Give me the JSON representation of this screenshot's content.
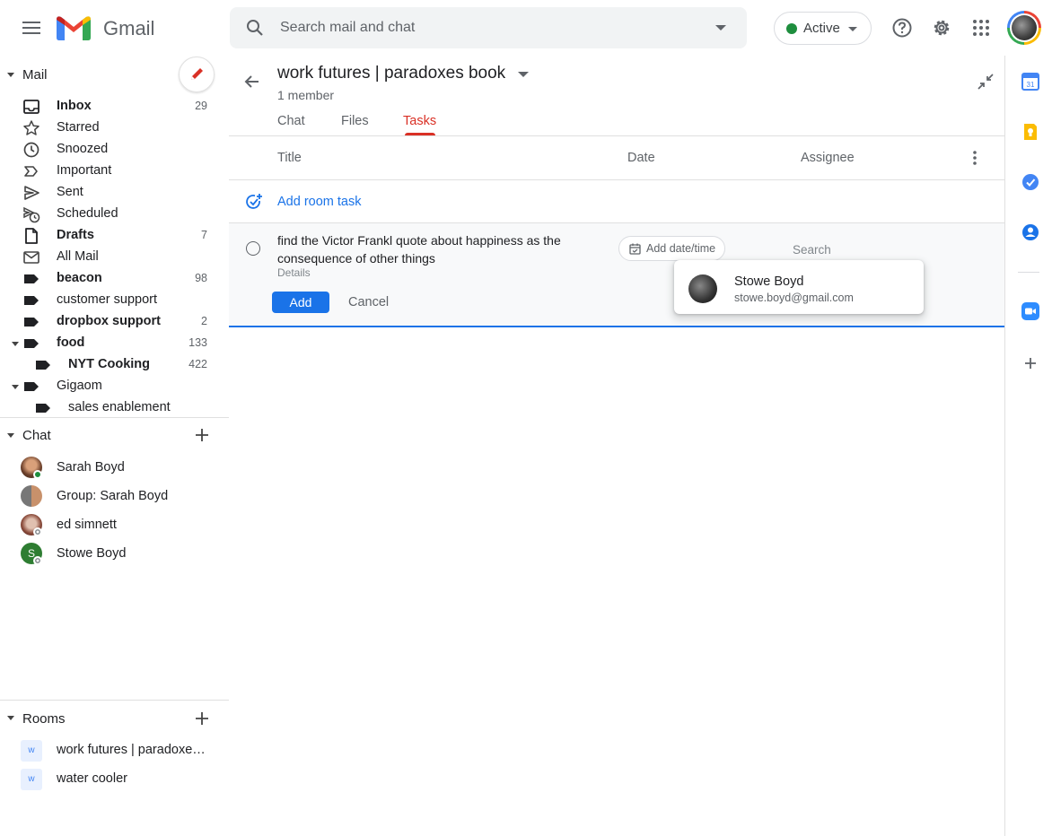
{
  "app": {
    "name": "Gmail"
  },
  "search": {
    "placeholder": "Search mail and chat"
  },
  "status": {
    "label": "Active",
    "color": "#1e8e3e"
  },
  "mail": {
    "section_title": "Mail",
    "items": [
      {
        "label": "Inbox",
        "count": "29",
        "icon": "inbox-icon",
        "bold": true
      },
      {
        "label": "Starred",
        "count": "",
        "icon": "star-icon",
        "bold": false
      },
      {
        "label": "Snoozed",
        "count": "",
        "icon": "clock-icon",
        "bold": false
      },
      {
        "label": "Important",
        "count": "",
        "icon": "important-icon",
        "bold": false
      },
      {
        "label": "Sent",
        "count": "",
        "icon": "send-icon",
        "bold": false
      },
      {
        "label": "Scheduled",
        "count": "",
        "icon": "scheduled-icon",
        "bold": false
      },
      {
        "label": "Drafts",
        "count": "7",
        "icon": "draft-icon",
        "bold": true
      },
      {
        "label": "All Mail",
        "count": "",
        "icon": "mail-icon",
        "bold": false
      },
      {
        "label": "beacon",
        "count": "98",
        "icon": "label-icon",
        "bold": true
      },
      {
        "label": "customer support",
        "count": "",
        "icon": "label-icon",
        "bold": false
      },
      {
        "label": "dropbox support",
        "count": "2",
        "icon": "label-icon",
        "bold": true
      },
      {
        "label": "food",
        "count": "133",
        "icon": "label-icon",
        "bold": true
      },
      {
        "label": "NYT Cooking",
        "count": "422",
        "icon": "label-icon",
        "bold": true
      },
      {
        "label": "Gigaom",
        "count": "",
        "icon": "label-icon",
        "bold": false
      },
      {
        "label": "sales enablement",
        "count": "",
        "icon": "label-icon",
        "bold": false
      }
    ]
  },
  "chat": {
    "section_title": "Chat",
    "items": [
      {
        "label": "Sarah Boyd"
      },
      {
        "label": "Group: Sarah Boyd"
      },
      {
        "label": "ed simnett"
      },
      {
        "label": "Stowe Boyd",
        "initial": "S"
      }
    ]
  },
  "rooms": {
    "section_title": "Rooms",
    "items": [
      {
        "label": "work futures | paradoxes book",
        "initial": "w"
      },
      {
        "label": "water cooler",
        "initial": "w"
      }
    ]
  },
  "room": {
    "title": "work futures | paradoxes book",
    "members": "1 member",
    "tabs": [
      {
        "label": "Chat",
        "active": false
      },
      {
        "label": "Files",
        "active": false
      },
      {
        "label": "Tasks",
        "active": true
      }
    ]
  },
  "tasks": {
    "columns": {
      "title": "Title",
      "date": "Date",
      "assignee": "Assignee"
    },
    "add_task_label": "Add room task",
    "editor": {
      "text": "find the Victor Frankl quote about happiness as the consequence of other things",
      "details_placeholder": "Details",
      "date_chip": "Add date/time",
      "assignee_placeholder": "Search",
      "add_label": "Add",
      "cancel_label": "Cancel"
    },
    "assignee_suggestion": {
      "name": "Stowe Boyd",
      "email": "stowe.boyd@gmail.com"
    }
  },
  "colors": {
    "accent": "#1a73e8",
    "active_tab": "#d93025"
  }
}
